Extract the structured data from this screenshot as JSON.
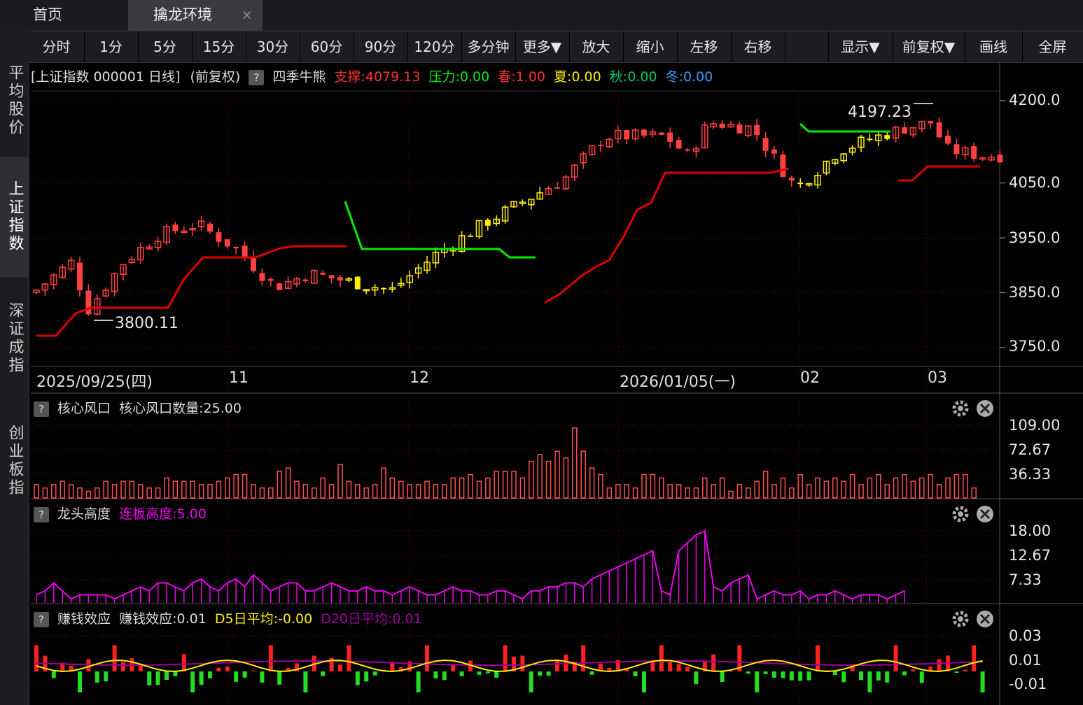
{
  "tabs": {
    "home": "首页",
    "active": "擒龙环境",
    "close": "×"
  },
  "sidebar": [
    {
      "label": "平均股价"
    },
    {
      "label": "上证指数"
    },
    {
      "label": "深证成指"
    },
    {
      "label": "创业板指"
    }
  ],
  "toolbar": [
    "分时",
    "1分",
    "5分",
    "15分",
    "30分",
    "60分",
    "90分",
    "120分",
    "多分钟",
    "更多▼",
    "放大",
    "缩小",
    "左移",
    "右移",
    "显示▼",
    "前复权▼",
    "画线",
    "全屏"
  ],
  "main_header": {
    "title": "[上证指数 000001 日线]",
    "adjust": "(前复权)",
    "help": "?",
    "indicator": "四季牛熊",
    "support_label": "支撑:4079.13",
    "pressure_label": "压力:0.00",
    "spring": "春:1.00",
    "summer": "夏:0.00",
    "autumn": "秋:0.00",
    "winter": "冬:0.00"
  },
  "price_axis": [
    "4200.0",
    "4050.0",
    "3950.0",
    "3850.0",
    "3750.0"
  ],
  "dates": [
    "2025/09/25(四)",
    "11",
    "12",
    "2026/01/05(一)",
    "02",
    "03"
  ],
  "annotations": {
    "high": "4197.23",
    "low": "3800.11"
  },
  "panel1": {
    "help": "?",
    "title": "核心风口",
    "value": "核心风口数量:25.00",
    "axis": [
      "109.00",
      "72.67",
      "36.33"
    ]
  },
  "panel2": {
    "help": "?",
    "title": "龙头高度",
    "value": "连板高度:5.00",
    "axis": [
      "18.00",
      "12.67",
      "7.33"
    ]
  },
  "panel3": {
    "help": "?",
    "title": "赚钱效应",
    "value": "赚钱效应:0.01",
    "d5": "D5日平均:-0.00",
    "d20": "D20日平均:0.01",
    "axis": [
      "0.03",
      "0.01",
      "-0.01"
    ]
  },
  "icons": {
    "gear": "gear-icon",
    "close": "close-icon"
  },
  "colors": {
    "up": "#ff4040",
    "down_yellow": "#ffee00",
    "green": "#00ee00",
    "support": "#e00000",
    "magenta": "#ee00ee",
    "grid": "#3a0000"
  },
  "chart_data": [
    {
      "type": "candlestick",
      "title": "上证指数 000001 日线",
      "ylim": [
        3720,
        4230
      ],
      "grid": true,
      "support_last": 4079.13,
      "high": 4197.23,
      "low": 3800.11
    },
    {
      "type": "bar",
      "title": "核心风口",
      "ylim": [
        0,
        109
      ],
      "last": 25.0
    },
    {
      "type": "area",
      "title": "龙头高度",
      "ylim": [
        0,
        18
      ],
      "last": 5.0
    },
    {
      "type": "bar",
      "title": "赚钱效应",
      "ylim": [
        -0.02,
        0.035
      ],
      "last": 0.01,
      "series": [
        {
          "name": "D5日平均",
          "last": -0.0
        },
        {
          "name": "D20日平均",
          "last": 0.01
        }
      ]
    }
  ]
}
